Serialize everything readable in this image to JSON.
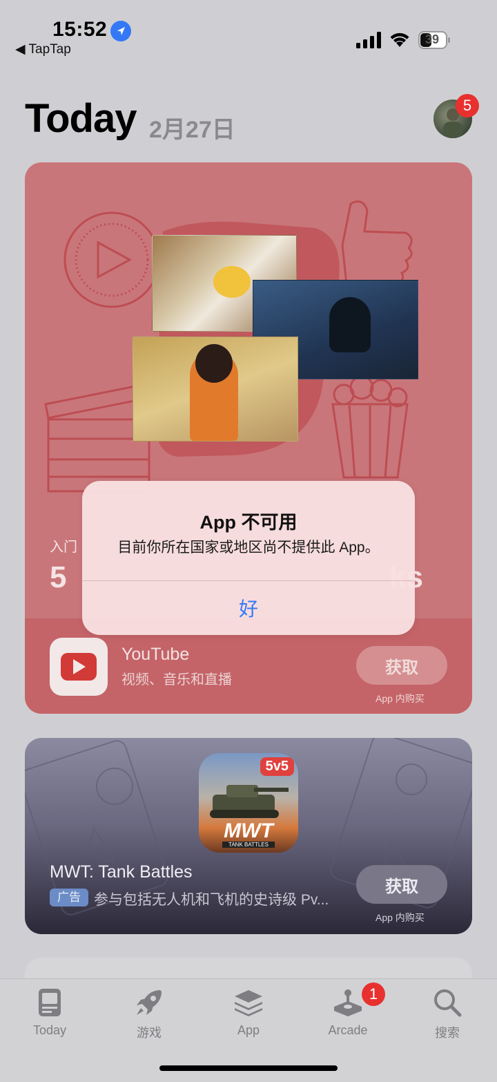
{
  "status_bar": {
    "time": "15:52",
    "back_app": "◀ TapTap",
    "battery": "39"
  },
  "header": {
    "title": "Today",
    "date": "2月27日",
    "avatar_badge": "5"
  },
  "feature_card": {
    "category": "入门",
    "headline_left": "5",
    "headline_right": "ks",
    "app": {
      "name": "YouTube",
      "subtitle": "视频、音乐和直播",
      "get_label": "获取",
      "iap_label": "App 内购买"
    }
  },
  "ad_card": {
    "icon_badge": "5v5",
    "icon_logo": "MWT",
    "icon_logo_sub": "TANK BATTLES",
    "name": "MWT: Tank Battles",
    "ad_tag": "广告",
    "description": "参与包括无人机和飞机的史诗级 Pv...",
    "get_label": "获取",
    "iap_label": "App 内购买"
  },
  "alert": {
    "title": "App 不可用",
    "message": "目前你所在国家或地区尚不提供此 App。",
    "ok_label": "好"
  },
  "tabbar": {
    "tabs": [
      {
        "label": "Today",
        "icon": "today-icon"
      },
      {
        "label": "游戏",
        "icon": "rocket-icon"
      },
      {
        "label": "App",
        "icon": "layers-icon"
      },
      {
        "label": "Arcade",
        "icon": "joystick-icon"
      },
      {
        "label": "搜索",
        "icon": "search-icon"
      }
    ],
    "arcade_badge": "1"
  },
  "colors": {
    "accent": "#3478f6",
    "badge": "#e8312f",
    "feature_card": "#c9767a",
    "ad_tag": "#6b8cc7"
  }
}
